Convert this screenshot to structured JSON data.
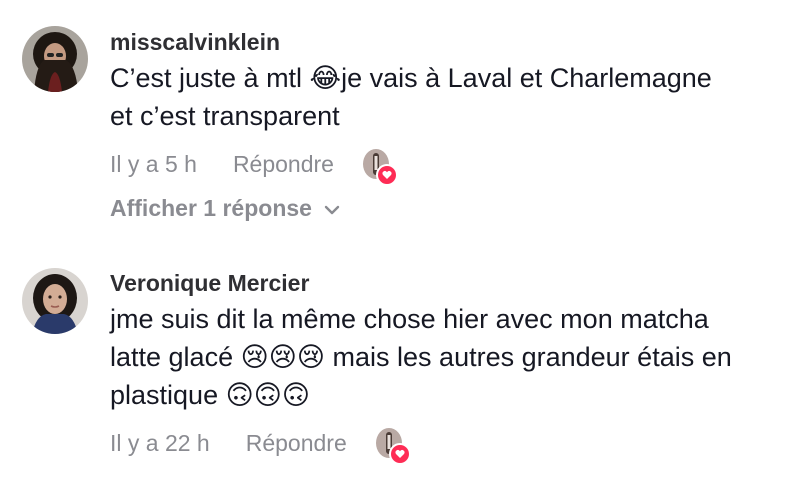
{
  "comments": [
    {
      "username": "misscalvinklein",
      "text": "C’est juste à mtl 😂je vais à Laval et Charlemagne\net c’est transparent",
      "time": "Il y a 5 h",
      "reply_label": "Répondre",
      "view_replies": "Afficher 1 réponse"
    },
    {
      "username": "Veronique Mercier",
      "text": "jme suis dit la même chose hier avec mon matcha\nlatte glacé 😢😢😢 mais les autres grandeur étais en\nplastique 🙃🙃🙃",
      "time": "Il y a 22 h",
      "reply_label": "Répondre"
    }
  ],
  "icons": {
    "creator_liked": "creator-liked-icon",
    "chevron": "chevron-down-icon"
  },
  "colors": {
    "text": "#161823",
    "muted": "#8a8b91",
    "like": "#fe2c55"
  }
}
